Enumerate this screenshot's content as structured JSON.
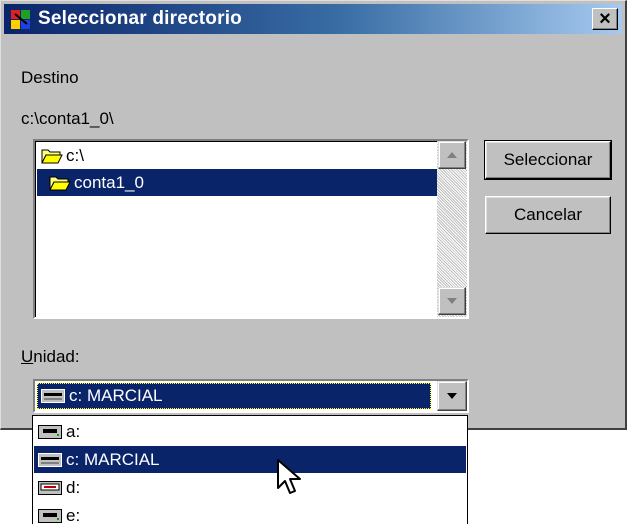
{
  "window": {
    "title": "Seleccionar directorio",
    "close_glyph": "×"
  },
  "labels": {
    "destino": "Destino",
    "path": "c:\\conta1_0\\",
    "unidad_u": "U",
    "unidad_rest": "nidad:"
  },
  "folders": [
    {
      "label": "c:\\",
      "icon": "open-folder-icon",
      "selected": false
    },
    {
      "label": "conta1_0",
      "icon": "open-folder-icon",
      "selected": true
    }
  ],
  "buttons": {
    "select": "Seleccionar",
    "cancel": "Cancelar"
  },
  "drive_combo": {
    "selected": "c: MARCIAL"
  },
  "drive_options": [
    {
      "label": "a:",
      "icon": "floppy-drive-icon",
      "selected": false
    },
    {
      "label": "c: MARCIAL",
      "icon": "hard-drive-icon",
      "selected": true
    },
    {
      "label": "d:",
      "icon": "cdrom-drive-icon",
      "selected": false
    },
    {
      "label": "e:",
      "icon": "floppy-drive-icon",
      "selected": false
    }
  ],
  "colors": {
    "face": "#c0c0c0",
    "selection": "#0a246a",
    "title_start": "#0a246a",
    "title_end": "#a6caf0"
  }
}
